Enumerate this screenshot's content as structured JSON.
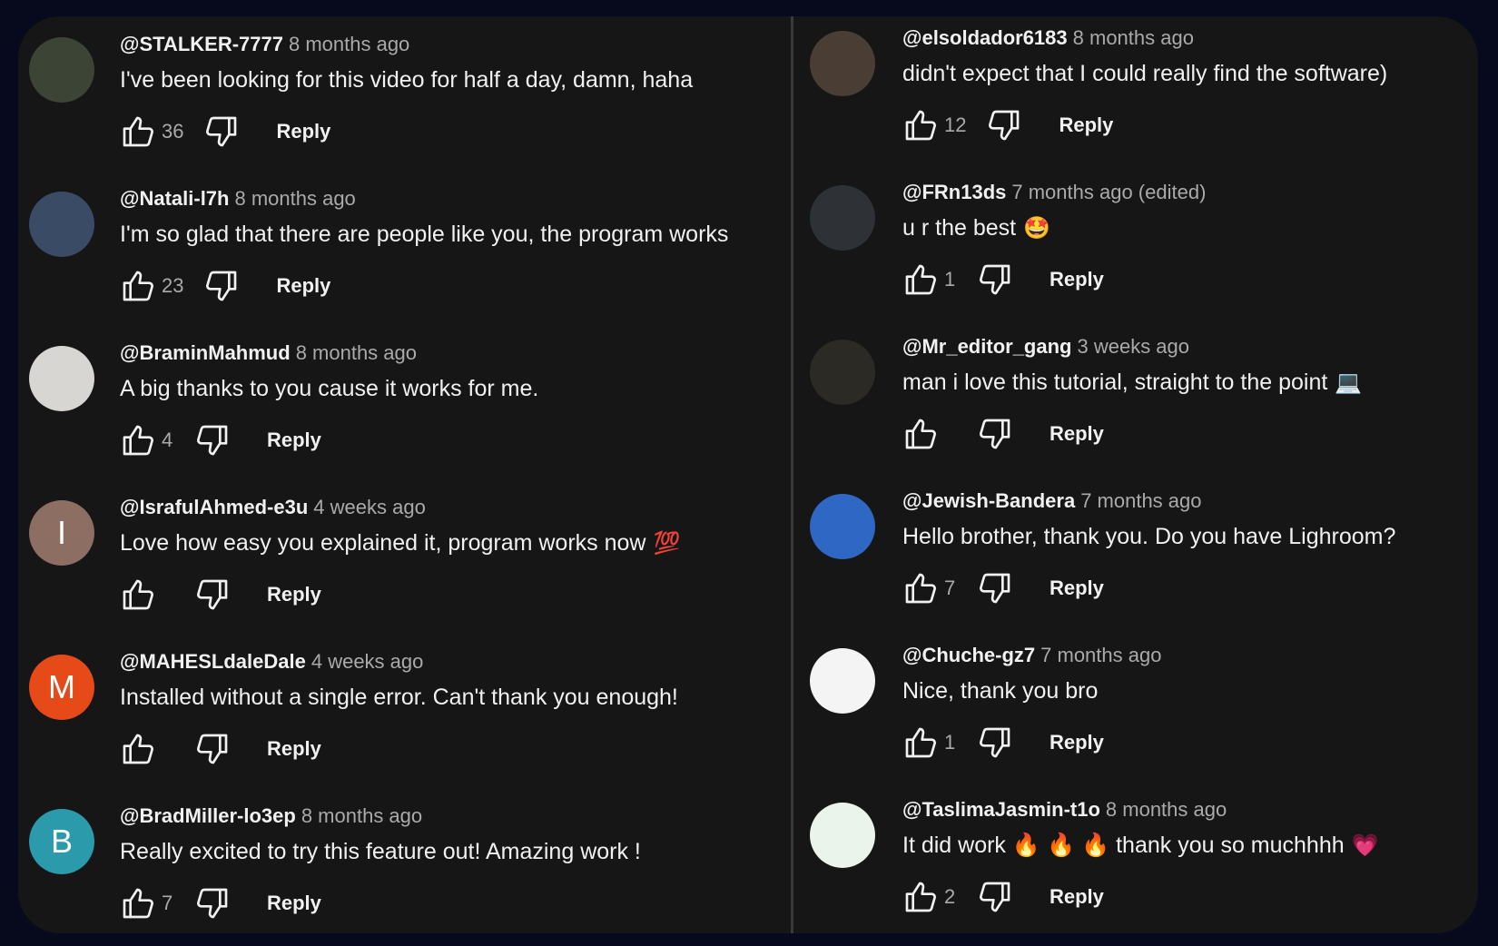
{
  "left": [
    {
      "handle": "@STALKER-7777",
      "time": "8 months ago",
      "text": "I've been looking for this video for half a day, damn, haha",
      "emoji": "",
      "likes": "36",
      "reply": "Reply",
      "avatar": {
        "letter": "",
        "color": "#3b4435"
      }
    },
    {
      "handle": "@Natali-l7h",
      "time": "8 months ago",
      "text": "I'm so glad that there are people like you, the program works",
      "emoji": "",
      "likes": "23",
      "reply": "Reply",
      "avatar": {
        "letter": "",
        "color": "#3a4b66"
      }
    },
    {
      "handle": "@BraminMahmud",
      "time": "8 months ago",
      "text": "A big thanks to you cause it works for me.",
      "emoji": "",
      "likes": "4",
      "reply": "Reply",
      "avatar": {
        "letter": "",
        "color": "#d8d6d2"
      }
    },
    {
      "handle": "@IsrafulAhmed-e3u",
      "time": "4 weeks ago",
      "text": "Love how easy you explained it, program works now",
      "emoji": "💯",
      "likes": "",
      "reply": "Reply",
      "avatar": {
        "letter": "I",
        "color": "#8d6e63"
      }
    },
    {
      "handle": "@MAHESLdaleDale",
      "time": "4 weeks ago",
      "text": "Installed without a single error. Can't thank you enough!",
      "emoji": "",
      "likes": "",
      "reply": "Reply",
      "avatar": {
        "letter": "M",
        "color": "#e64a19"
      }
    },
    {
      "handle": "@BradMiller-lo3ep",
      "time": "8 months ago",
      "text": "Really excited to try this feature out! Amazing work !",
      "emoji": "",
      "likes": "7",
      "reply": "Reply",
      "avatar": {
        "letter": "B",
        "color": "#2b9aab"
      }
    }
  ],
  "right": [
    {
      "handle": "@elsoldador6183",
      "time": "8 months ago",
      "text": "didn't expect that I could really find the software)",
      "emoji": "",
      "likes": "12",
      "reply": "Reply",
      "avatar": {
        "letter": "",
        "color": "#4a3e34"
      }
    },
    {
      "handle": "@FRn13ds",
      "time": "7 months ago (edited)",
      "text": "u r the best",
      "emoji": "🤩",
      "likes": "1",
      "reply": "Reply",
      "avatar": {
        "letter": "",
        "color": "#2e3136"
      }
    },
    {
      "handle": "@Mr_editor_gang",
      "time": "3 weeks ago",
      "text": "man i love this tutorial, straight to the point",
      "emoji": "💻",
      "likes": "",
      "reply": "Reply",
      "avatar": {
        "letter": "",
        "color": "#2c2a24"
      }
    },
    {
      "handle": "@Jewish-Bandera",
      "time": "7 months ago",
      "text": "Hello brother, thank you. Do you have Lighroom?",
      "emoji": "",
      "likes": "7",
      "reply": "Reply",
      "avatar": {
        "letter": "",
        "color": "#2f67c4"
      }
    },
    {
      "handle": "@Chuche-gz7",
      "time": "7 months ago",
      "text": "Nice, thank you bro",
      "emoji": "",
      "likes": "1",
      "reply": "Reply",
      "avatar": {
        "letter": "",
        "color": "#f4f4f4"
      }
    },
    {
      "handle": "@TaslimaJasmin-t1o",
      "time": "8 months ago",
      "text": "It did work 🔥 🔥 🔥  thank you so muchhhh",
      "emoji": "💗",
      "likes": "2",
      "reply": "Reply",
      "avatar": {
        "letter": "",
        "color": "#eaf4ea"
      }
    }
  ]
}
